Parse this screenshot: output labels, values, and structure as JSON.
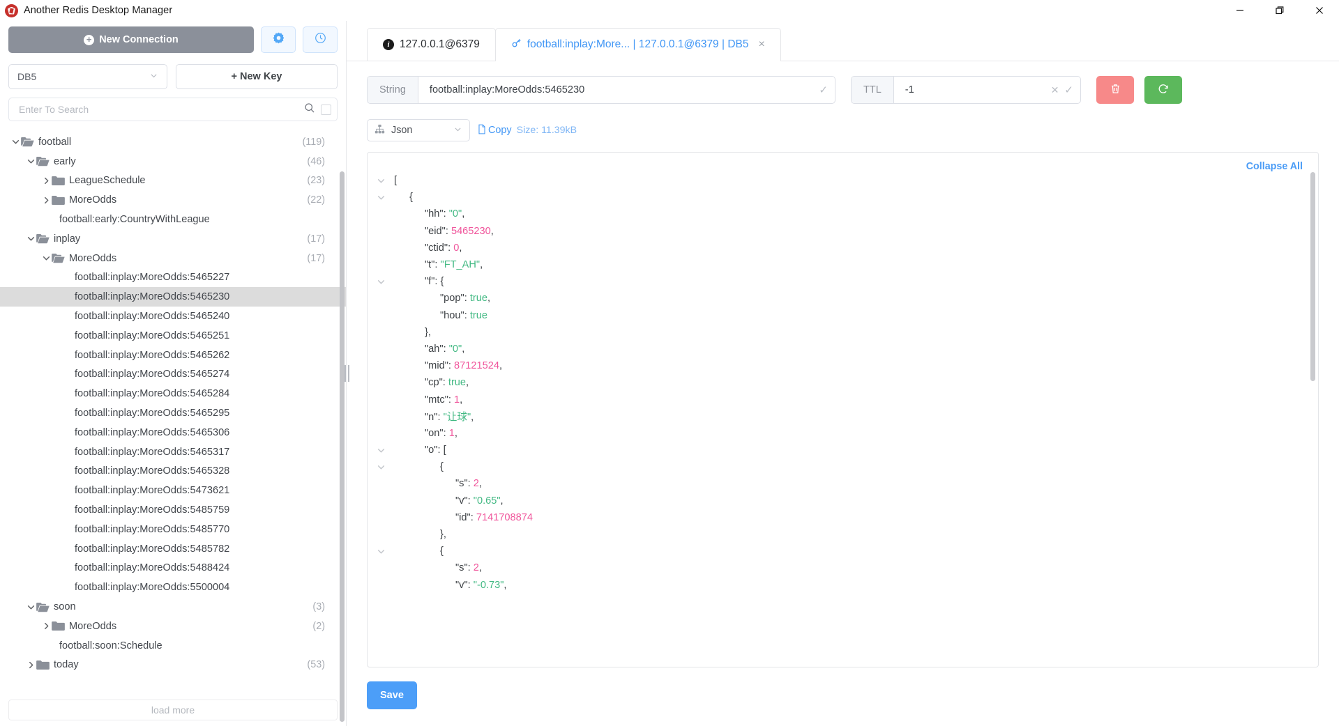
{
  "window": {
    "title": "Another Redis Desktop Manager",
    "logo_icon": "redis-logo-icon",
    "minimize_label": "Minimize",
    "maximize_label": "Maximize",
    "close_label": "Close"
  },
  "sidebar": {
    "new_connection_label": "New Connection",
    "settings_icon": "gear-icon",
    "history_icon": "clock-icon",
    "db_selected": "DB5",
    "new_key_label": "+ New Key",
    "search_placeholder": "Enter To Search",
    "search_value": "",
    "search_icon": "search-icon",
    "search_checkbox": "regex-checkbox",
    "load_more_label": "load more",
    "tree": [
      {
        "label": "football",
        "count": "(119)",
        "depth": 0,
        "type": "folder-open",
        "caret": "down",
        "selected": false
      },
      {
        "label": "early",
        "count": "(46)",
        "depth": 1,
        "type": "folder-open",
        "caret": "down",
        "selected": false
      },
      {
        "label": "LeagueSchedule",
        "count": "(23)",
        "depth": 2,
        "type": "folder-closed",
        "caret": "right",
        "selected": false
      },
      {
        "label": "MoreOdds",
        "count": "(22)",
        "depth": 2,
        "type": "folder-closed",
        "caret": "right",
        "selected": false
      },
      {
        "label": "football:early:CountryWithLeague",
        "count": "",
        "depth": 2,
        "type": "key",
        "caret": "none",
        "selected": false
      },
      {
        "label": "inplay",
        "count": "(17)",
        "depth": 1,
        "type": "folder-open",
        "caret": "down",
        "selected": false
      },
      {
        "label": "MoreOdds",
        "count": "(17)",
        "depth": 2,
        "type": "folder-open",
        "caret": "down",
        "selected": false
      },
      {
        "label": "football:inplay:MoreOdds:5465227",
        "count": "",
        "depth": 3,
        "type": "key",
        "caret": "none",
        "selected": false
      },
      {
        "label": "football:inplay:MoreOdds:5465230",
        "count": "",
        "depth": 3,
        "type": "key",
        "caret": "none",
        "selected": true
      },
      {
        "label": "football:inplay:MoreOdds:5465240",
        "count": "",
        "depth": 3,
        "type": "key",
        "caret": "none",
        "selected": false
      },
      {
        "label": "football:inplay:MoreOdds:5465251",
        "count": "",
        "depth": 3,
        "type": "key",
        "caret": "none",
        "selected": false
      },
      {
        "label": "football:inplay:MoreOdds:5465262",
        "count": "",
        "depth": 3,
        "type": "key",
        "caret": "none",
        "selected": false
      },
      {
        "label": "football:inplay:MoreOdds:5465274",
        "count": "",
        "depth": 3,
        "type": "key",
        "caret": "none",
        "selected": false
      },
      {
        "label": "football:inplay:MoreOdds:5465284",
        "count": "",
        "depth": 3,
        "type": "key",
        "caret": "none",
        "selected": false
      },
      {
        "label": "football:inplay:MoreOdds:5465295",
        "count": "",
        "depth": 3,
        "type": "key",
        "caret": "none",
        "selected": false
      },
      {
        "label": "football:inplay:MoreOdds:5465306",
        "count": "",
        "depth": 3,
        "type": "key",
        "caret": "none",
        "selected": false
      },
      {
        "label": "football:inplay:MoreOdds:5465317",
        "count": "",
        "depth": 3,
        "type": "key",
        "caret": "none",
        "selected": false
      },
      {
        "label": "football:inplay:MoreOdds:5465328",
        "count": "",
        "depth": 3,
        "type": "key",
        "caret": "none",
        "selected": false
      },
      {
        "label": "football:inplay:MoreOdds:5473621",
        "count": "",
        "depth": 3,
        "type": "key",
        "caret": "none",
        "selected": false
      },
      {
        "label": "football:inplay:MoreOdds:5485759",
        "count": "",
        "depth": 3,
        "type": "key",
        "caret": "none",
        "selected": false
      },
      {
        "label": "football:inplay:MoreOdds:5485770",
        "count": "",
        "depth": 3,
        "type": "key",
        "caret": "none",
        "selected": false
      },
      {
        "label": "football:inplay:MoreOdds:5485782",
        "count": "",
        "depth": 3,
        "type": "key",
        "caret": "none",
        "selected": false
      },
      {
        "label": "football:inplay:MoreOdds:5488424",
        "count": "",
        "depth": 3,
        "type": "key",
        "caret": "none",
        "selected": false
      },
      {
        "label": "football:inplay:MoreOdds:5500004",
        "count": "",
        "depth": 3,
        "type": "key",
        "caret": "none",
        "selected": false
      },
      {
        "label": "soon",
        "count": "(3)",
        "depth": 1,
        "type": "folder-open",
        "caret": "down",
        "selected": false
      },
      {
        "label": "MoreOdds",
        "count": "(2)",
        "depth": 2,
        "type": "folder-closed",
        "caret": "right",
        "selected": false
      },
      {
        "label": "football:soon:Schedule",
        "count": "",
        "depth": 2,
        "type": "key",
        "caret": "none",
        "selected": false
      },
      {
        "label": "today",
        "count": "(53)",
        "depth": 1,
        "type": "folder-closed",
        "caret": "right",
        "selected": false
      }
    ]
  },
  "tabs": [
    {
      "label": "127.0.0.1@6379",
      "icon": "info-icon",
      "active": false,
      "closable": false
    },
    {
      "label": "football:inplay:More... | 127.0.0.1@6379 | DB5",
      "icon": "key-icon",
      "active": true,
      "closable": true,
      "close_label": "×"
    }
  ],
  "key_toolbar": {
    "type_label": "String",
    "key_value": "football:inplay:MoreOdds:5465230",
    "key_confirm_icon": "check-icon",
    "ttl_label": "TTL",
    "ttl_value": "-1",
    "ttl_clear_icon": "x-icon",
    "ttl_confirm_icon": "check-icon",
    "delete_icon": "trash-icon",
    "refresh_icon": "refresh-icon"
  },
  "format_row": {
    "format_icon": "tree-view-icon",
    "format_value": "Json",
    "chevron_icon": "chevron-down-icon",
    "copy_icon": "copy-icon",
    "copy_label": "Copy",
    "size_label": "Size: 11.39kB"
  },
  "viewer": {
    "collapse_all_label": "Collapse All",
    "lines": [
      {
        "indent": 0,
        "caret": "down",
        "parts": [
          {
            "t": "punc",
            "v": "["
          }
        ]
      },
      {
        "indent": 1,
        "caret": "down",
        "parts": [
          {
            "t": "punc",
            "v": "{"
          }
        ]
      },
      {
        "indent": 2,
        "caret": "none",
        "parts": [
          {
            "t": "key",
            "v": "\"hh\": "
          },
          {
            "t": "str",
            "v": "\"0\""
          },
          {
            "t": "punc",
            "v": ","
          }
        ]
      },
      {
        "indent": 2,
        "caret": "none",
        "parts": [
          {
            "t": "key",
            "v": "\"eid\": "
          },
          {
            "t": "num",
            "v": "5465230"
          },
          {
            "t": "punc",
            "v": ","
          }
        ]
      },
      {
        "indent": 2,
        "caret": "none",
        "parts": [
          {
            "t": "key",
            "v": "\"ctid\": "
          },
          {
            "t": "num",
            "v": "0"
          },
          {
            "t": "punc",
            "v": ","
          }
        ]
      },
      {
        "indent": 2,
        "caret": "none",
        "parts": [
          {
            "t": "key",
            "v": "\"t\": "
          },
          {
            "t": "str",
            "v": "\"FT_AH\""
          },
          {
            "t": "punc",
            "v": ","
          }
        ]
      },
      {
        "indent": 2,
        "caret": "down",
        "parts": [
          {
            "t": "key",
            "v": "\"f\": "
          },
          {
            "t": "punc",
            "v": "{"
          }
        ]
      },
      {
        "indent": 3,
        "caret": "none",
        "parts": [
          {
            "t": "key",
            "v": "\"pop\": "
          },
          {
            "t": "bool",
            "v": "true"
          },
          {
            "t": "punc",
            "v": ","
          }
        ]
      },
      {
        "indent": 3,
        "caret": "none",
        "parts": [
          {
            "t": "key",
            "v": "\"hou\": "
          },
          {
            "t": "bool",
            "v": "true"
          }
        ]
      },
      {
        "indent": 2,
        "caret": "none",
        "parts": [
          {
            "t": "punc",
            "v": "},"
          }
        ]
      },
      {
        "indent": 2,
        "caret": "none",
        "parts": [
          {
            "t": "key",
            "v": "\"ah\": "
          },
          {
            "t": "str",
            "v": "\"0\""
          },
          {
            "t": "punc",
            "v": ","
          }
        ]
      },
      {
        "indent": 2,
        "caret": "none",
        "parts": [
          {
            "t": "key",
            "v": "\"mid\": "
          },
          {
            "t": "num",
            "v": "87121524"
          },
          {
            "t": "punc",
            "v": ","
          }
        ]
      },
      {
        "indent": 2,
        "caret": "none",
        "parts": [
          {
            "t": "key",
            "v": "\"cp\": "
          },
          {
            "t": "bool",
            "v": "true"
          },
          {
            "t": "punc",
            "v": ","
          }
        ]
      },
      {
        "indent": 2,
        "caret": "none",
        "parts": [
          {
            "t": "key",
            "v": "\"mtc\": "
          },
          {
            "t": "num",
            "v": "1"
          },
          {
            "t": "punc",
            "v": ","
          }
        ]
      },
      {
        "indent": 2,
        "caret": "none",
        "parts": [
          {
            "t": "key",
            "v": "\"n\": "
          },
          {
            "t": "str",
            "v": "\"让球\""
          },
          {
            "t": "punc",
            "v": ","
          }
        ]
      },
      {
        "indent": 2,
        "caret": "none",
        "parts": [
          {
            "t": "key",
            "v": "\"on\": "
          },
          {
            "t": "num",
            "v": "1"
          },
          {
            "t": "punc",
            "v": ","
          }
        ]
      },
      {
        "indent": 2,
        "caret": "down",
        "parts": [
          {
            "t": "key",
            "v": "\"o\": "
          },
          {
            "t": "punc",
            "v": "["
          }
        ]
      },
      {
        "indent": 3,
        "caret": "down",
        "parts": [
          {
            "t": "punc",
            "v": "{"
          }
        ]
      },
      {
        "indent": 4,
        "caret": "none",
        "parts": [
          {
            "t": "key",
            "v": "\"s\": "
          },
          {
            "t": "num",
            "v": "2"
          },
          {
            "t": "punc",
            "v": ","
          }
        ]
      },
      {
        "indent": 4,
        "caret": "none",
        "parts": [
          {
            "t": "key",
            "v": "\"v\": "
          },
          {
            "t": "str",
            "v": "\"0.65\""
          },
          {
            "t": "punc",
            "v": ","
          }
        ]
      },
      {
        "indent": 4,
        "caret": "none",
        "parts": [
          {
            "t": "key",
            "v": "\"id\": "
          },
          {
            "t": "num",
            "v": "7141708874"
          }
        ]
      },
      {
        "indent": 3,
        "caret": "none",
        "parts": [
          {
            "t": "punc",
            "v": "},"
          }
        ]
      },
      {
        "indent": 3,
        "caret": "down",
        "parts": [
          {
            "t": "punc",
            "v": "{"
          }
        ]
      },
      {
        "indent": 4,
        "caret": "none",
        "parts": [
          {
            "t": "key",
            "v": "\"s\": "
          },
          {
            "t": "num",
            "v": "2"
          },
          {
            "t": "punc",
            "v": ","
          }
        ]
      },
      {
        "indent": 4,
        "caret": "none",
        "parts": [
          {
            "t": "key",
            "v": "\"v\": "
          },
          {
            "t": "str",
            "v": "\"-0.73\""
          },
          {
            "t": "punc",
            "v": ","
          }
        ]
      }
    ]
  },
  "footer": {
    "save_label": "Save"
  }
}
